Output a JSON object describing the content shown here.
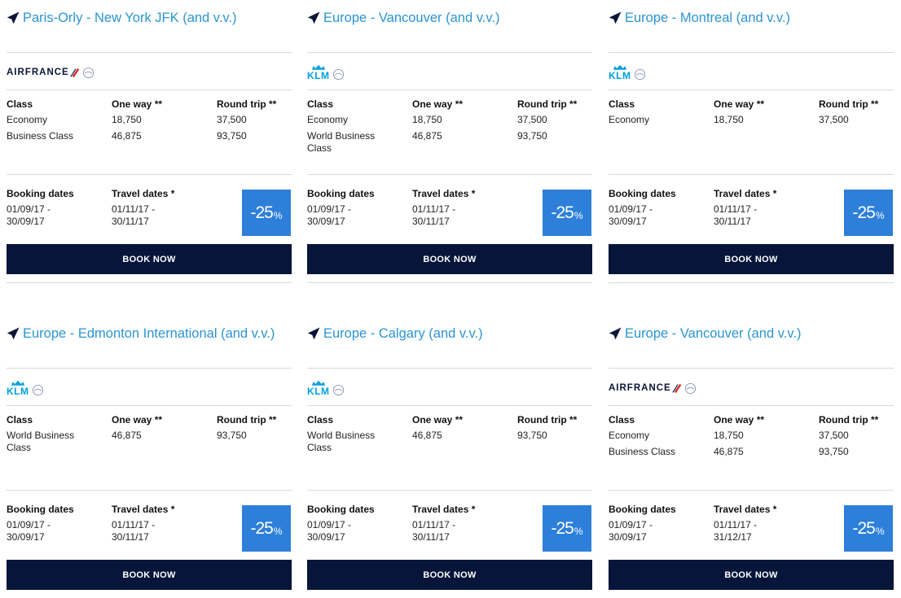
{
  "labels": {
    "class": "Class",
    "one_way": "One way **",
    "round_trip": "Round trip **",
    "booking_dates": "Booking dates",
    "travel_dates": "Travel dates *",
    "book_now": "BOOK NOW",
    "airfrance_logo": "AIRFRANCE",
    "klm_logo": "KLM"
  },
  "colors": {
    "title_blue": "#2a95d1",
    "badge_blue": "#2d7fda",
    "button_navy": "#061539",
    "af_red": "#e2231a",
    "klm_blue": "#00a1de"
  },
  "cards": [
    {
      "route": "Paris-Orly - New York JFK (and v.v.)",
      "airline": "airfrance",
      "fares": [
        {
          "class": "Economy",
          "one_way": "18,750",
          "round_trip": "37,500"
        },
        {
          "class": "Business Class",
          "one_way": "46,875",
          "round_trip": "93,750"
        }
      ],
      "booking_dates": [
        "01/09/17 -",
        "30/09/17"
      ],
      "travel_dates": [
        "01/11/17 -",
        "30/11/17"
      ],
      "discount": "-25",
      "discount_unit": "%"
    },
    {
      "route": "Europe - Vancouver (and v.v.)",
      "airline": "klm",
      "fares": [
        {
          "class": "Economy",
          "one_way": "18,750",
          "round_trip": "37,500"
        },
        {
          "class": "World Business Class",
          "one_way": "46,875",
          "round_trip": "93,750"
        }
      ],
      "booking_dates": [
        "01/09/17 -",
        "30/09/17"
      ],
      "travel_dates": [
        "01/11/17 -",
        "30/11/17"
      ],
      "discount": "-25",
      "discount_unit": "%"
    },
    {
      "route": "Europe - Montreal (and v.v.)",
      "airline": "klm",
      "fares": [
        {
          "class": "Economy",
          "one_way": "18,750",
          "round_trip": "37,500"
        }
      ],
      "booking_dates": [
        "01/09/17 -",
        "30/09/17"
      ],
      "travel_dates": [
        "01/11/17 -",
        "30/11/17"
      ],
      "discount": "-25",
      "discount_unit": "%"
    },
    {
      "route": "Europe - Edmonton International (and v.v.)",
      "airline": "klm",
      "fares": [
        {
          "class": "World Business Class",
          "one_way": "46,875",
          "round_trip": "93,750"
        }
      ],
      "booking_dates": [
        "01/09/17 -",
        "30/09/17"
      ],
      "travel_dates": [
        "01/11/17 -",
        "30/11/17"
      ],
      "discount": "-25",
      "discount_unit": "%"
    },
    {
      "route": "Europe - Calgary (and v.v.)",
      "airline": "klm",
      "fares": [
        {
          "class": "World Business Class",
          "one_way": "46,875",
          "round_trip": "93,750"
        }
      ],
      "booking_dates": [
        "01/09/17 -",
        "30/09/17"
      ],
      "travel_dates": [
        "01/11/17 -",
        "30/11/17"
      ],
      "discount": "-25",
      "discount_unit": "%"
    },
    {
      "route": "Europe - Vancouver (and v.v.)",
      "airline": "airfrance",
      "fares": [
        {
          "class": "Economy",
          "one_way": "18,750",
          "round_trip": "37,500"
        },
        {
          "class": "Business Class",
          "one_way": "46,875",
          "round_trip": "93,750"
        }
      ],
      "booking_dates": [
        "01/09/17 -",
        "30/09/17"
      ],
      "travel_dates": [
        "01/11/17 -",
        "31/12/17"
      ],
      "discount": "-25",
      "discount_unit": "%"
    }
  ]
}
